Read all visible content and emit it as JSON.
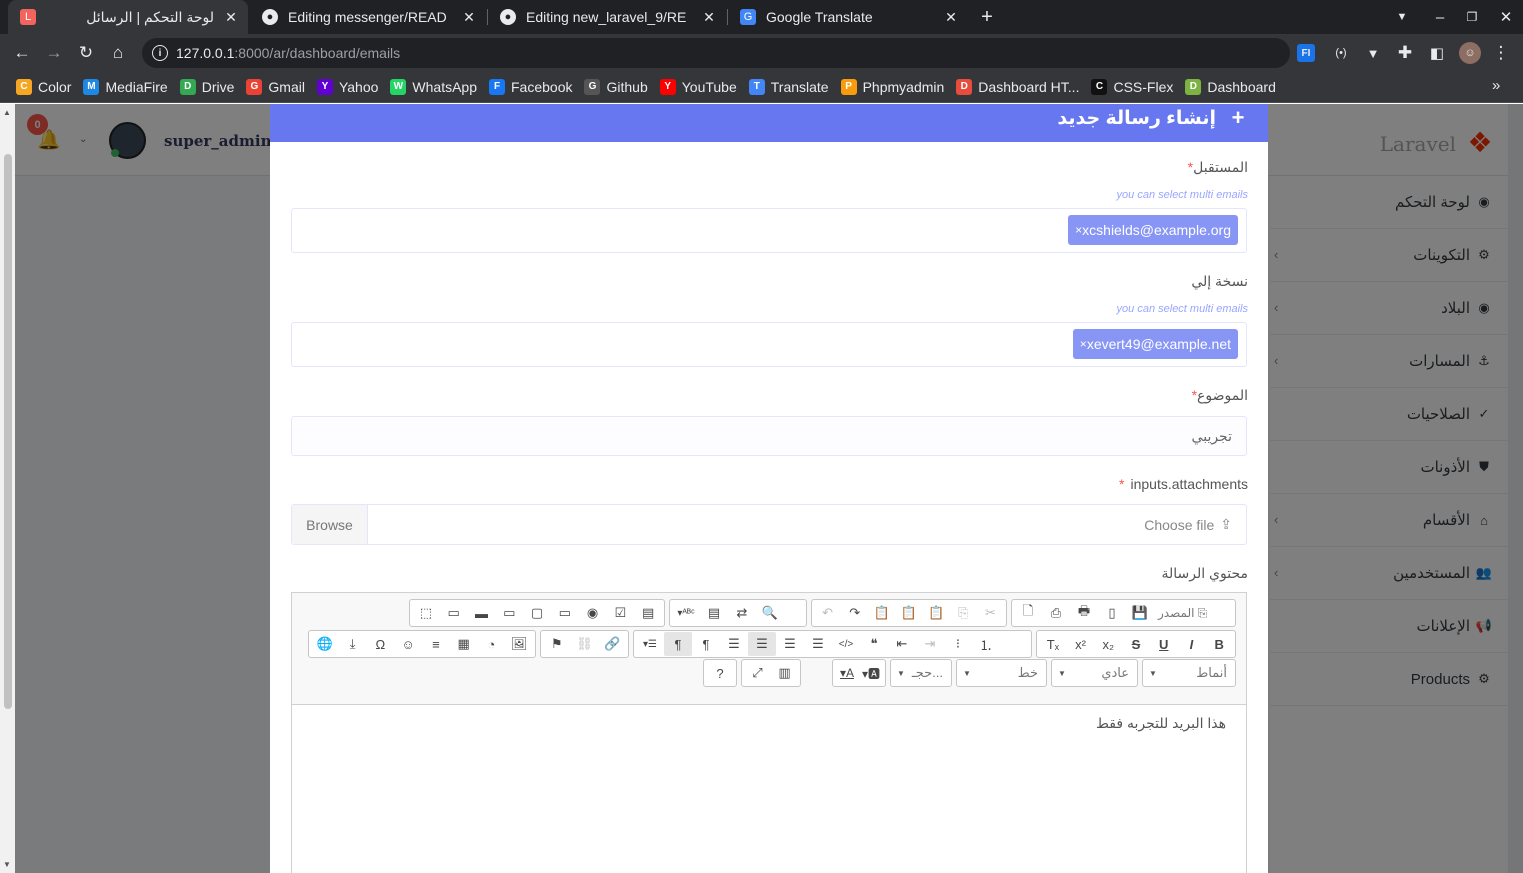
{
  "tabs": [
    {
      "title": "لوحة التحكم | الرسائل",
      "favicon": "laravel-icon",
      "active": true
    },
    {
      "title": "Editing messenger/READ",
      "favicon": "github-icon"
    },
    {
      "title": "Editing new_laravel_9/RE",
      "favicon": "github-icon"
    },
    {
      "title": "Google Translate",
      "favicon": "google-translate-icon"
    }
  ],
  "address": {
    "host": "127.0.0.1",
    "path": ":8000/ar/dashboard/emails"
  },
  "bookmarks": [
    {
      "label": "Color",
      "icon": "color-icon",
      "color": "#f5a623"
    },
    {
      "label": "MediaFire",
      "icon": "mediafire-icon",
      "color": "#1e88e5"
    },
    {
      "label": "Drive",
      "icon": "drive-icon",
      "color": "#34a853"
    },
    {
      "label": "Gmail",
      "icon": "gmail-icon",
      "color": "#ea4335"
    },
    {
      "label": "Yahoo",
      "icon": "yahoo-icon",
      "color": "#6001d2"
    },
    {
      "label": "WhatsApp",
      "icon": "whatsapp-icon",
      "color": "#25d366"
    },
    {
      "label": "Facebook",
      "icon": "facebook-icon",
      "color": "#1877f2"
    },
    {
      "label": "Github",
      "icon": "github-icon",
      "color": "#555555"
    },
    {
      "label": "YouTube",
      "icon": "youtube-icon",
      "color": "#ff0000"
    },
    {
      "label": "Translate",
      "icon": "translate-icon",
      "color": "#4285f4"
    },
    {
      "label": "Phpmyadmin",
      "icon": "phpmyadmin-icon",
      "color": "#f89c0e"
    },
    {
      "label": "Dashboard HT...",
      "icon": "dashboard-icon",
      "color": "#e74c3c"
    },
    {
      "label": "CSS-Flex",
      "icon": "cssflex-icon",
      "color": "#111111"
    },
    {
      "label": "Dashboard",
      "icon": "dashboard-icon",
      "color": "#7cb342"
    }
  ],
  "header": {
    "username": "super_admin ,",
    "notifications": "0"
  },
  "brand": {
    "name": "Laravel"
  },
  "sidebar": [
    {
      "label": "لوحة التحكم",
      "icon": "dashboard-icon",
      "glyph": "◉",
      "chevron": false
    },
    {
      "label": "التكوينات",
      "icon": "cogs-icon",
      "glyph": "⚙",
      "chevron": true
    },
    {
      "label": "البلاد",
      "icon": "globe-icon",
      "glyph": "◉",
      "chevron": true
    },
    {
      "label": "المسارات",
      "icon": "anchor-icon",
      "glyph": "⚓",
      "chevron": true
    },
    {
      "label": "الصلاحيات",
      "icon": "check-icon",
      "glyph": "✓",
      "chevron": false
    },
    {
      "label": "الأذونات",
      "icon": "shield-icon",
      "glyph": "⛊",
      "chevron": false
    },
    {
      "label": "الأقسام",
      "icon": "home-icon",
      "glyph": "⌂",
      "chevron": true
    },
    {
      "label": "المستخدمين",
      "icon": "users-icon",
      "glyph": "👥",
      "chevron": true
    },
    {
      "label": "الإعلانات",
      "icon": "bullhorn-icon",
      "glyph": "📢",
      "chevron": false
    },
    {
      "label": "Products",
      "icon": "cogs-icon",
      "glyph": "⚙",
      "chevron": false
    }
  ],
  "modal": {
    "title": "إنشاء رسالة جديد",
    "to": {
      "label": "المستقبل",
      "hint": "you can select multi emails",
      "tag": "xcshields@example.org"
    },
    "cc": {
      "label": "نسخة إلي",
      "hint": "you can select multi emails",
      "tag": "xevert49@example.net"
    },
    "subject": {
      "label": "الموضوع",
      "value": "تجريبي"
    },
    "attachments": {
      "label": "inputs.attachments",
      "choose": "Choose file",
      "browse": "Browse"
    },
    "content": {
      "label": "محتوي الرسالة",
      "body": "هذا البريد للتجربه فقط"
    }
  },
  "editor": {
    "source_label": "المصدر",
    "combos": {
      "styles": "أنماط",
      "format": "عادي",
      "font": "خط",
      "size": "حجـ..."
    }
  }
}
